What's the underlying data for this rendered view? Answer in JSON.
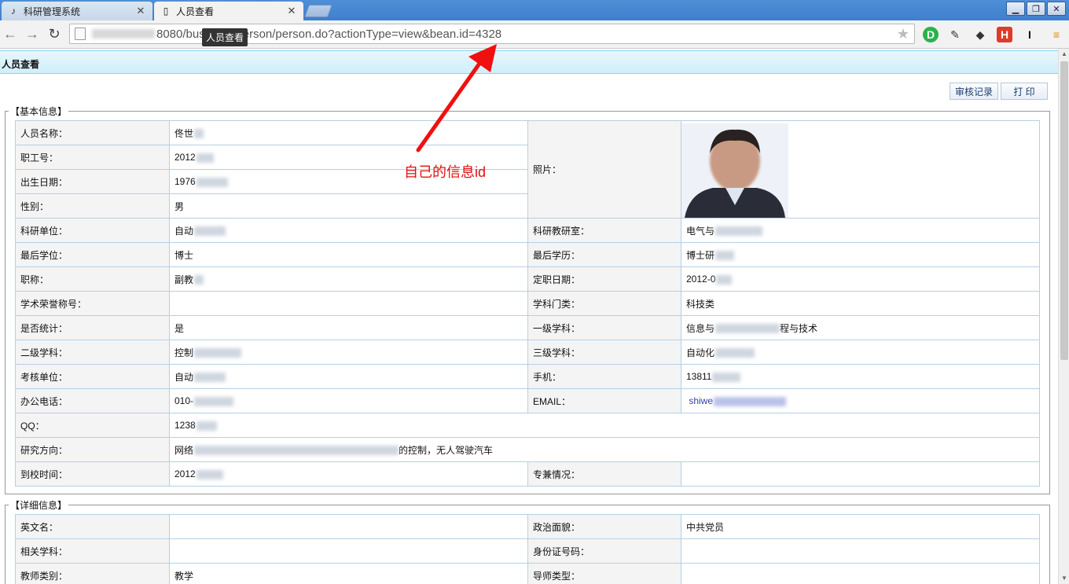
{
  "browser": {
    "tabs": [
      {
        "label": "科研管理系统",
        "active": false
      },
      {
        "label": "人员查看",
        "active": true
      }
    ],
    "url": "8080/business/person/person.do?actionType=view&bean.id=4328",
    "url_visible_prefix": "8080/bus",
    "url_visible_suffix": "erson/person.do?actionType=view&bean.id=4328",
    "tooltip": "人员查看",
    "extensions": [
      "onenote-icon",
      "puzzle-icon",
      "evernote-icon",
      "translate-icon",
      "ibeam-icon",
      "menu-icon"
    ]
  },
  "page": {
    "title": "人员查看",
    "buttons": {
      "audit": "审核记录",
      "print": "打 印"
    },
    "sections": {
      "basic": {
        "legend": "【基本信息】",
        "photo_label": "照片：",
        "rows": [
          {
            "l1": "人员名称：",
            "v1": "佟世"
          },
          {
            "l1": "职工号：",
            "v1": "2012"
          },
          {
            "l1": "出生日期：",
            "v1": "1976"
          },
          {
            "l1": "性别：",
            "v1": "男"
          },
          {
            "l1": "科研单位：",
            "v1": "自动",
            "l2": "科研教研室：",
            "v2": "电气与"
          },
          {
            "l1": "最后学位：",
            "v1": "博士",
            "l2": "最后学历：",
            "v2": "博士研"
          },
          {
            "l1": "职称：",
            "v1": "副教",
            "l2": "定职日期：",
            "v2": "2012-0"
          },
          {
            "l1": "学术荣誉称号：",
            "v1": "",
            "l2": "学科门类：",
            "v2": "科技类"
          },
          {
            "l1": "是否统计：",
            "v1": "是",
            "l2": "一级学科：",
            "v2": "信息与",
            "v2_suffix": "程与技术"
          },
          {
            "l1": "二级学科：",
            "v1": "控制",
            "l2": "三级学科：",
            "v2": "自动化"
          },
          {
            "l1": "考核单位：",
            "v1": "自动",
            "l2": "手机：",
            "v2": "13811"
          },
          {
            "l1": "办公电话：",
            "v1": "010-",
            "l2": "EMAIL：",
            "v2": "shiwe"
          },
          {
            "l1": "QQ：",
            "v1": "1238"
          },
          {
            "l1": "研究方向：",
            "v1": "网络",
            "v1_suffix": "的控制，无人驾驶汽车"
          },
          {
            "l1": "到校时间：",
            "v1": "2012",
            "l2": "专兼情况：",
            "v2": ""
          }
        ]
      },
      "detail": {
        "legend": "【详细信息】",
        "rows": [
          {
            "l1": "英文名：",
            "v1": "",
            "l2": "政治面貌：",
            "v2": "中共党员"
          },
          {
            "l1": "相关学科：",
            "v1": "",
            "l2": "身份证号码：",
            "v2": ""
          },
          {
            "l1": "教师类别：",
            "v1": "教学",
            "l2": "导师类型：",
            "v2": ""
          }
        ]
      }
    }
  },
  "annotation": {
    "text": "自己的信息id",
    "color": "#e01010"
  }
}
